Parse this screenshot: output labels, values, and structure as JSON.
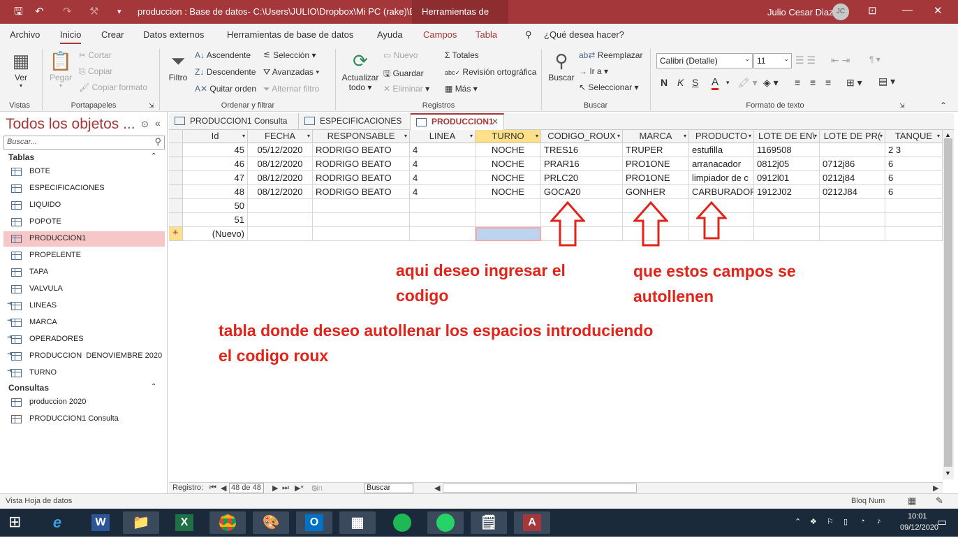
{
  "titlebar": {
    "doc_title": "produccion : Base de datos- C:\\Users\\JULIO\\Dropbox\\Mi PC (rake)\\Doc...",
    "context_tab": "Herramientas de tabla",
    "user_name": "Julio Cesar Diaz",
    "user_initials": "JC",
    "accent": "#a4373a"
  },
  "menu": {
    "items": [
      "Archivo",
      "Inicio",
      "Crear",
      "Datos externos",
      "Herramientas de base de datos",
      "Ayuda",
      "Campos",
      "Tabla"
    ],
    "tell_me": "¿Qué desea hacer?"
  },
  "ribbon": {
    "vistas": {
      "ver": "Ver",
      "label": "Vistas"
    },
    "portapapeles": {
      "pegar": "Pegar",
      "cortar": "Cortar",
      "copiar": "Copiar",
      "copiar_formato": "Copiar formato",
      "label": "Portapapeles"
    },
    "ordenar": {
      "filtro": "Filtro",
      "ascendente": "Ascendente",
      "descendente": "Descendente",
      "quitar_orden": "Quitar orden",
      "seleccion": "Selección",
      "avanzadas": "Avanzadas",
      "alternar": "Alternar filtro",
      "label": "Ordenar y filtrar"
    },
    "registros": {
      "actualizar": "Actualizar",
      "todo": "todo",
      "nuevo": "Nuevo",
      "guardar": "Guardar",
      "eliminar": "Eliminar",
      "totales": "Totales",
      "revision": "Revisión ortográfica",
      "mas": "Más",
      "label": "Registros"
    },
    "buscar": {
      "buscar": "Buscar",
      "reemplazar": "Reemplazar",
      "ir_a": "Ir a",
      "seleccionar": "Seleccionar",
      "label": "Buscar"
    },
    "formato": {
      "font": "Calibri (Detalle)",
      "size": "11",
      "bold": "N",
      "italic": "K",
      "underline": "S",
      "label": "Formato de texto"
    }
  },
  "nav": {
    "title": "Todos los objetos ...",
    "search_placeholder": "Buscar...",
    "tablas_label": "Tablas",
    "tablas": [
      "BOTE",
      "ESPECIFICACIONES",
      "LIQUIDO",
      "POPOTE",
      "PRODUCCION1",
      "PROPELENTE",
      "TAPA",
      "VALVULA",
      "LINEAS",
      "MARCA",
      "OPERADORES",
      "PRODUCCION  DENOVIEMBRE 2020",
      "TURNO"
    ],
    "consultas_label": "Consultas",
    "consultas": [
      "produccion 2020",
      "PRODUCCION1 Consulta"
    ]
  },
  "doc_tabs": [
    "PRODUCCION1 Consulta",
    "ESPECIFICACIONES",
    "PRODUCCION1"
  ],
  "columns": [
    "Id",
    "FECHA",
    "RESPONSABLE",
    "LINEA",
    "TURNO",
    "CODIGO_ROUX",
    "MARCA",
    "PRODUCTO",
    "LOTE DE EN\\",
    "LOTE DE PR(",
    "TANQUE"
  ],
  "rows": [
    [
      "45",
      "05/12/2020",
      "RODRIGO BEATO",
      "4",
      "NOCHE",
      "TRES16",
      "TRUPER",
      "estufilla",
      "1169508",
      "",
      "2 3"
    ],
    [
      "46",
      "08/12/2020",
      "RODRIGO BEATO",
      "4",
      "NOCHE",
      "PRAR16",
      "PRO1ONE",
      "arranacador",
      "0812j05",
      "0712j86",
      "6"
    ],
    [
      "47",
      "08/12/2020",
      "RODRIGO BEATO",
      "4",
      "NOCHE",
      "PRLC20",
      "PRO1ONE",
      "limpiador de c",
      "0912l01",
      "0212j84",
      "6"
    ],
    [
      "48",
      "08/12/2020",
      "RODRIGO BEATO",
      "4",
      "NOCHE",
      "GOCA20",
      "GONHER",
      "CARBURADOR",
      "1912J02",
      "0212J84",
      "6"
    ],
    [
      "50",
      "",
      "",
      "",
      "",
      "",
      "",
      "",
      "",
      "",
      ""
    ],
    [
      "51",
      "",
      "",
      "",
      "",
      "",
      "",
      "",
      "",
      "",
      ""
    ]
  ],
  "new_row_label": "(Nuevo)",
  "annotations": {
    "code": [
      "aqui deseo ingresar el",
      "codigo"
    ],
    "autofill": [
      "que estos campos se",
      "autollenen"
    ],
    "table": [
      "tabla donde deseo autollenar los espacios introduciendo",
      "el codigo  roux"
    ]
  },
  "record_nav": {
    "label": "Registro:",
    "position": "48 de 48",
    "filter": "Sin filtro",
    "search": "Buscar"
  },
  "status": {
    "left": "Vista Hoja de datos",
    "right": "Bloq Num"
  },
  "taskbar": {
    "time": "10:01",
    "date": "09/12/2020"
  }
}
